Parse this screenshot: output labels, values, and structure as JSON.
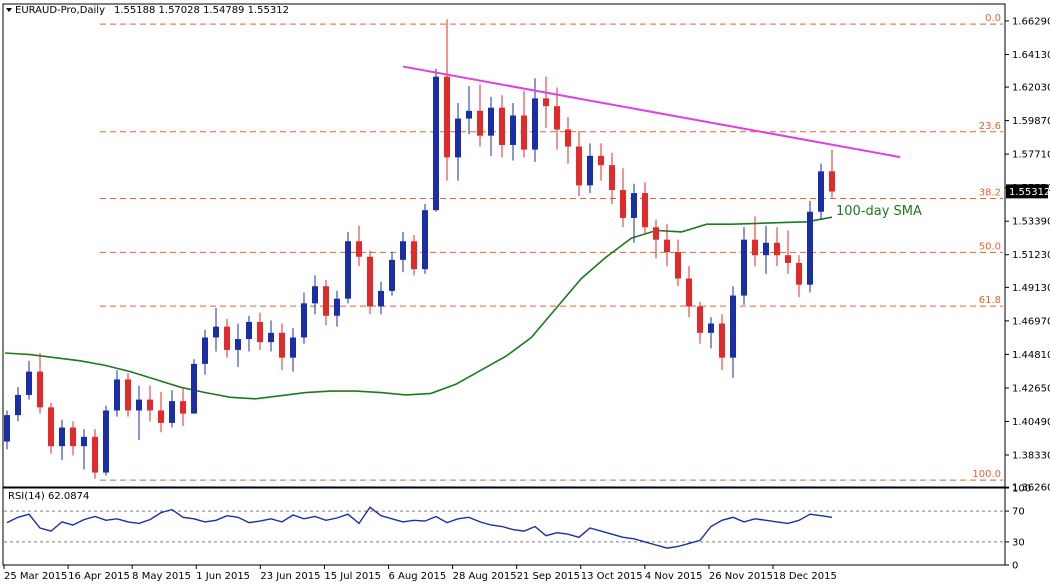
{
  "chart_data": {
    "type": "candlestick",
    "header": {
      "symbol": "EURAUD-Pro,Daily",
      "ohlc": "1.55188 1.57028 1.54789 1.55312"
    },
    "last_price": 1.55312,
    "last_price_label": "1.55312",
    "y_range": [
      1.3627,
      1.6738
    ],
    "y_ticks": [
      1.6629,
      1.6413,
      1.6203,
      1.5987,
      1.5771,
      1.5555,
      1.5339,
      1.5123,
      1.4913,
      1.4697,
      1.4481,
      1.4265,
      1.4049,
      1.3833,
      1.3626
    ],
    "y_tick_labels": [
      "1.66290",
      "1.64130",
      "1.62030",
      "1.59870",
      "1.57710",
      "1.55550",
      "1.53390",
      "1.51230",
      "1.49130",
      "1.46970",
      "1.44810",
      "1.42650",
      "1.40490",
      "1.38330",
      "1.36260"
    ],
    "x_tick_labels": [
      "25 Mar 2015",
      "16 Apr 2015",
      "8 May 2015",
      "1 Jun 2015",
      "23 Jun 2015",
      "15 Jul 2015",
      "6 Aug 2015",
      "28 Aug 2015",
      "21 Sep 2015",
      "13 Oct 2015",
      "4 Nov 2015",
      "26 Nov 2015",
      "18 Dec 2015"
    ],
    "fibonacci": {
      "levels": [
        {
          "label": "0.0",
          "price": 1.6608
        },
        {
          "label": "23.6",
          "price": 1.5915
        },
        {
          "label": "38.2",
          "price": 1.5485
        },
        {
          "label": "50.0",
          "price": 1.5138
        },
        {
          "label": "61.8",
          "price": 1.4792
        },
        {
          "label": "100.0",
          "price": 1.3671
        }
      ],
      "color": "#e9632a"
    },
    "trendline": {
      "color": "#e040e0",
      "start_price": 1.6335,
      "end_price": 1.5752
    },
    "sma": {
      "label": "100-day SMA",
      "color": "#1e7a1e",
      "points": [
        1.449,
        1.448,
        1.446,
        1.444,
        1.441,
        1.437,
        1.432,
        1.427,
        1.4235,
        1.4205,
        1.4195,
        1.4215,
        1.4235,
        1.4245,
        1.4245,
        1.4235,
        1.422,
        1.423,
        1.429,
        1.438,
        1.447,
        1.459,
        1.478,
        1.497,
        1.511,
        1.523,
        1.528,
        1.527,
        1.532,
        1.532,
        1.5325,
        1.533,
        1.5335,
        1.5365
      ]
    },
    "rsi": {
      "label": "RSI(14) 62.0874",
      "levels": [
        70,
        30
      ],
      "ticks": [
        100,
        70,
        30,
        0
      ],
      "tick_labels": [
        "100",
        "70",
        "30",
        "0"
      ],
      "color": "#1a2ea8",
      "values": [
        55,
        62,
        66,
        48,
        44,
        56,
        52,
        59,
        63,
        58,
        60,
        56,
        54,
        59,
        68,
        72,
        62,
        60,
        56,
        58,
        64,
        62,
        55,
        57,
        60,
        56,
        65,
        60,
        63,
        58,
        61,
        66,
        54,
        75,
        64,
        60,
        56,
        58,
        57,
        63,
        55,
        60,
        62,
        56,
        52,
        50,
        46,
        44,
        50,
        38,
        42,
        40,
        36,
        48,
        44,
        40,
        36,
        34,
        30,
        26,
        22,
        24,
        28,
        32,
        50,
        58,
        62,
        56,
        60,
        58,
        56,
        54,
        58,
        66,
        64,
        62
      ]
    },
    "colors": {
      "up": "#1a2ea8",
      "down": "#e22a2a"
    },
    "candles": [
      {
        "o": 1.392,
        "h": 1.412,
        "l": 1.387,
        "c": 1.409
      },
      {
        "o": 1.409,
        "h": 1.427,
        "l": 1.405,
        "c": 1.422
      },
      {
        "o": 1.422,
        "h": 1.444,
        "l": 1.419,
        "c": 1.437
      },
      {
        "o": 1.437,
        "h": 1.449,
        "l": 1.41,
        "c": 1.414
      },
      {
        "o": 1.414,
        "h": 1.417,
        "l": 1.384,
        "c": 1.389
      },
      {
        "o": 1.389,
        "h": 1.406,
        "l": 1.38,
        "c": 1.401
      },
      {
        "o": 1.401,
        "h": 1.405,
        "l": 1.383,
        "c": 1.389
      },
      {
        "o": 1.389,
        "h": 1.4,
        "l": 1.374,
        "c": 1.395
      },
      {
        "o": 1.395,
        "h": 1.4,
        "l": 1.368,
        "c": 1.372
      },
      {
        "o": 1.372,
        "h": 1.415,
        "l": 1.37,
        "c": 1.412
      },
      {
        "o": 1.412,
        "h": 1.438,
        "l": 1.408,
        "c": 1.432
      },
      {
        "o": 1.432,
        "h": 1.436,
        "l": 1.408,
        "c": 1.412
      },
      {
        "o": 1.412,
        "h": 1.428,
        "l": 1.393,
        "c": 1.419
      },
      {
        "o": 1.419,
        "h": 1.428,
        "l": 1.405,
        "c": 1.412
      },
      {
        "o": 1.412,
        "h": 1.424,
        "l": 1.398,
        "c": 1.404
      },
      {
        "o": 1.404,
        "h": 1.425,
        "l": 1.401,
        "c": 1.418
      },
      {
        "o": 1.418,
        "h": 1.426,
        "l": 1.402,
        "c": 1.41
      },
      {
        "o": 1.41,
        "h": 1.445,
        "l": 1.41,
        "c": 1.442
      },
      {
        "o": 1.442,
        "h": 1.464,
        "l": 1.435,
        "c": 1.459
      },
      {
        "o": 1.459,
        "h": 1.478,
        "l": 1.45,
        "c": 1.466
      },
      {
        "o": 1.466,
        "h": 1.471,
        "l": 1.446,
        "c": 1.451
      },
      {
        "o": 1.451,
        "h": 1.468,
        "l": 1.44,
        "c": 1.458
      },
      {
        "o": 1.458,
        "h": 1.473,
        "l": 1.45,
        "c": 1.469
      },
      {
        "o": 1.469,
        "h": 1.475,
        "l": 1.451,
        "c": 1.456
      },
      {
        "o": 1.456,
        "h": 1.47,
        "l": 1.45,
        "c": 1.462
      },
      {
        "o": 1.462,
        "h": 1.468,
        "l": 1.438,
        "c": 1.446
      },
      {
        "o": 1.446,
        "h": 1.465,
        "l": 1.437,
        "c": 1.459
      },
      {
        "o": 1.459,
        "h": 1.488,
        "l": 1.455,
        "c": 1.481
      },
      {
        "o": 1.481,
        "h": 1.499,
        "l": 1.474,
        "c": 1.492
      },
      {
        "o": 1.492,
        "h": 1.496,
        "l": 1.467,
        "c": 1.473
      },
      {
        "o": 1.473,
        "h": 1.489,
        "l": 1.466,
        "c": 1.484
      },
      {
        "o": 1.484,
        "h": 1.527,
        "l": 1.481,
        "c": 1.521
      },
      {
        "o": 1.521,
        "h": 1.531,
        "l": 1.505,
        "c": 1.511
      },
      {
        "o": 1.511,
        "h": 1.515,
        "l": 1.474,
        "c": 1.479
      },
      {
        "o": 1.479,
        "h": 1.495,
        "l": 1.474,
        "c": 1.489
      },
      {
        "o": 1.489,
        "h": 1.514,
        "l": 1.486,
        "c": 1.509
      },
      {
        "o": 1.509,
        "h": 1.527,
        "l": 1.501,
        "c": 1.521
      },
      {
        "o": 1.521,
        "h": 1.525,
        "l": 1.499,
        "c": 1.503
      },
      {
        "o": 1.503,
        "h": 1.545,
        "l": 1.5,
        "c": 1.541
      },
      {
        "o": 1.541,
        "h": 1.632,
        "l": 1.54,
        "c": 1.627
      },
      {
        "o": 1.627,
        "h": 1.664,
        "l": 1.56,
        "c": 1.575
      },
      {
        "o": 1.575,
        "h": 1.61,
        "l": 1.56,
        "c": 1.6
      },
      {
        "o": 1.6,
        "h": 1.621,
        "l": 1.59,
        "c": 1.605
      },
      {
        "o": 1.605,
        "h": 1.622,
        "l": 1.582,
        "c": 1.589
      },
      {
        "o": 1.589,
        "h": 1.614,
        "l": 1.576,
        "c": 1.607
      },
      {
        "o": 1.607,
        "h": 1.615,
        "l": 1.575,
        "c": 1.583
      },
      {
        "o": 1.583,
        "h": 1.61,
        "l": 1.573,
        "c": 1.602
      },
      {
        "o": 1.602,
        "h": 1.618,
        "l": 1.575,
        "c": 1.58
      },
      {
        "o": 1.58,
        "h": 1.626,
        "l": 1.572,
        "c": 1.613
      },
      {
        "o": 1.613,
        "h": 1.627,
        "l": 1.594,
        "c": 1.608
      },
      {
        "o": 1.608,
        "h": 1.62,
        "l": 1.58,
        "c": 1.593
      },
      {
        "o": 1.593,
        "h": 1.601,
        "l": 1.571,
        "c": 1.582
      },
      {
        "o": 1.582,
        "h": 1.592,
        "l": 1.55,
        "c": 1.557
      },
      {
        "o": 1.557,
        "h": 1.584,
        "l": 1.552,
        "c": 1.576
      },
      {
        "o": 1.576,
        "h": 1.584,
        "l": 1.56,
        "c": 1.57
      },
      {
        "o": 1.57,
        "h": 1.578,
        "l": 1.545,
        "c": 1.554
      },
      {
        "o": 1.554,
        "h": 1.568,
        "l": 1.53,
        "c": 1.536
      },
      {
        "o": 1.536,
        "h": 1.558,
        "l": 1.52,
        "c": 1.552
      },
      {
        "o": 1.552,
        "h": 1.559,
        "l": 1.525,
        "c": 1.53
      },
      {
        "o": 1.53,
        "h": 1.535,
        "l": 1.51,
        "c": 1.522
      },
      {
        "o": 1.522,
        "h": 1.532,
        "l": 1.505,
        "c": 1.514
      },
      {
        "o": 1.514,
        "h": 1.522,
        "l": 1.492,
        "c": 1.497
      },
      {
        "o": 1.497,
        "h": 1.505,
        "l": 1.472,
        "c": 1.479
      },
      {
        "o": 1.479,
        "h": 1.482,
        "l": 1.455,
        "c": 1.462
      },
      {
        "o": 1.462,
        "h": 1.472,
        "l": 1.452,
        "c": 1.468
      },
      {
        "o": 1.468,
        "h": 1.474,
        "l": 1.438,
        "c": 1.446
      },
      {
        "o": 1.446,
        "h": 1.492,
        "l": 1.433,
        "c": 1.486
      },
      {
        "o": 1.486,
        "h": 1.53,
        "l": 1.48,
        "c": 1.522
      },
      {
        "o": 1.522,
        "h": 1.537,
        "l": 1.505,
        "c": 1.512
      },
      {
        "o": 1.512,
        "h": 1.531,
        "l": 1.5,
        "c": 1.52
      },
      {
        "o": 1.52,
        "h": 1.53,
        "l": 1.505,
        "c": 1.512
      },
      {
        "o": 1.512,
        "h": 1.528,
        "l": 1.5,
        "c": 1.507
      },
      {
        "o": 1.507,
        "h": 1.512,
        "l": 1.485,
        "c": 1.493
      },
      {
        "o": 1.493,
        "h": 1.547,
        "l": 1.488,
        "c": 1.54
      },
      {
        "o": 1.54,
        "h": 1.571,
        "l": 1.535,
        "c": 1.566
      },
      {
        "o": 1.566,
        "h": 1.58,
        "l": 1.549,
        "c": 1.553
      }
    ]
  }
}
